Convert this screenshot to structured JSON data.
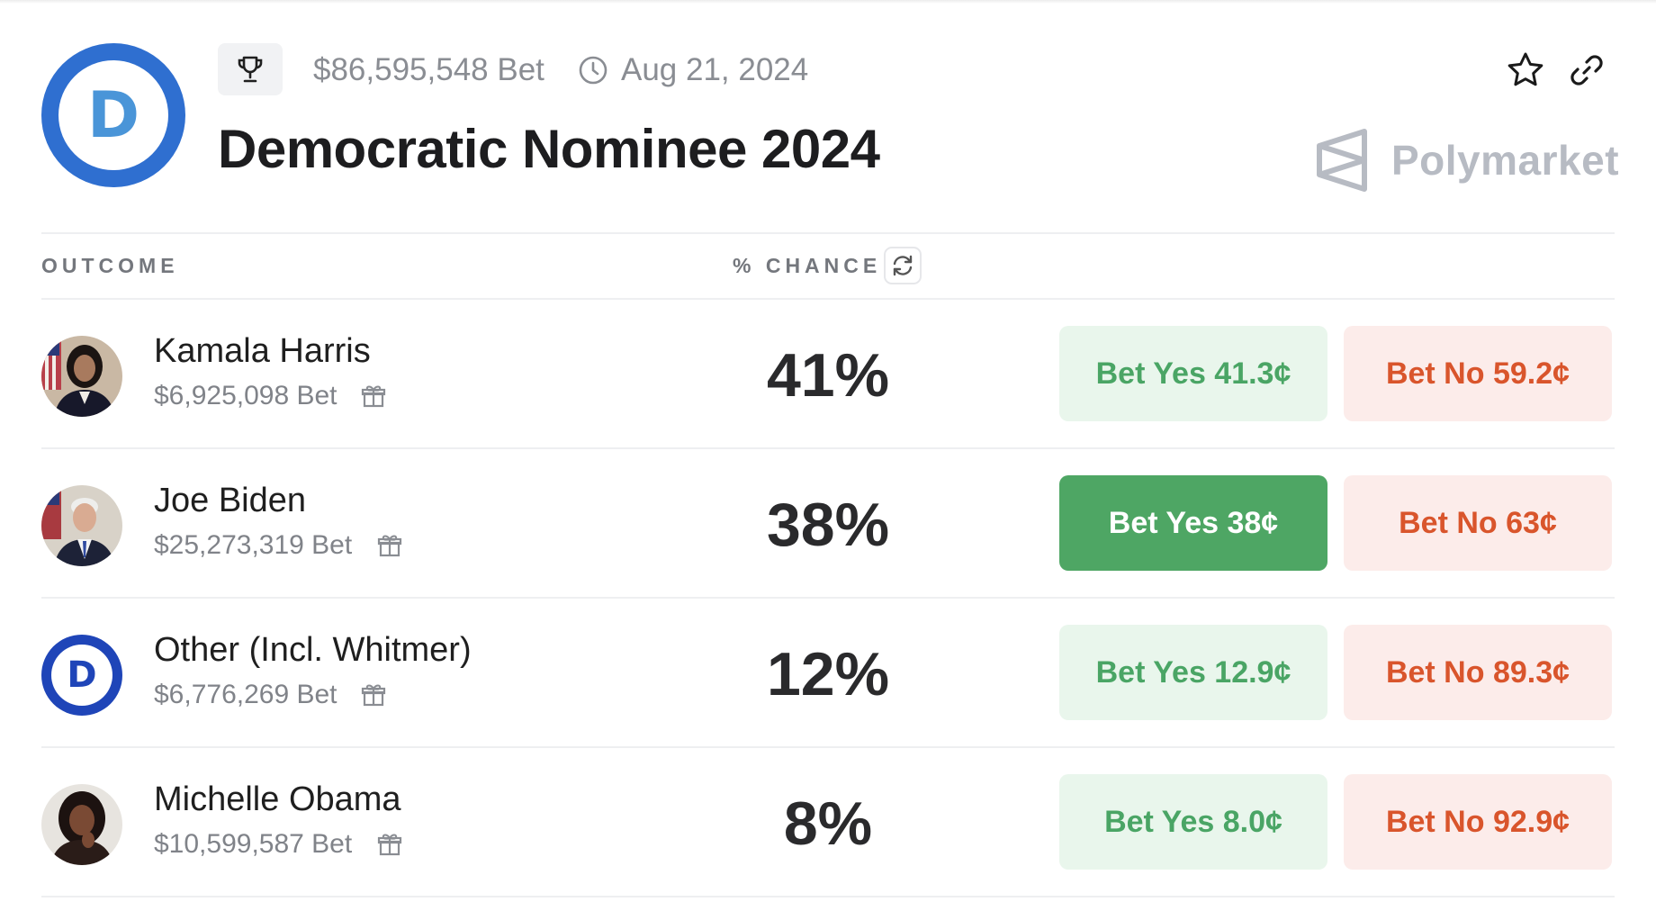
{
  "header": {
    "logo_letter": "D",
    "volume": "$86,595,548 Bet",
    "date": "Aug 21, 2024",
    "title": "Democratic Nominee 2024",
    "brand": "Polymarket"
  },
  "table": {
    "col_outcome": "OUTCOME",
    "col_chance": "% CHANCE"
  },
  "rows": [
    {
      "name": "Kamala Harris",
      "volume": "$6,925,098 Bet",
      "chance": "41%",
      "yes": "Bet Yes 41.3¢",
      "no": "Bet No 59.2¢"
    },
    {
      "name": "Joe Biden",
      "volume": "$25,273,319 Bet",
      "chance": "38%",
      "yes": "Bet Yes 38¢",
      "no": "Bet No 63¢"
    },
    {
      "name": "Other (Incl. Whitmer)",
      "volume": "$6,776,269 Bet",
      "chance": "12%",
      "yes": "Bet Yes 12.9¢",
      "no": "Bet No 89.3¢",
      "avatar_letter": "D"
    },
    {
      "name": "Michelle Obama",
      "volume": "$10,599,587 Bet",
      "chance": "8%",
      "yes": "Bet Yes 8.0¢",
      "no": "Bet No 92.9¢"
    }
  ],
  "icons": {
    "trophy": "trophy-icon",
    "clock": "clock-icon",
    "star": "star-icon",
    "link": "link-icon",
    "refresh": "refresh-icon",
    "gift": "gift-icon"
  },
  "colors": {
    "brand_blue": "#2f6fd0",
    "yes_green": "#4aa565",
    "yes_bg": "#e9f6ec",
    "yes_active_bg": "#4ea664",
    "no_red": "#d9552c",
    "no_bg": "#fcecea"
  }
}
